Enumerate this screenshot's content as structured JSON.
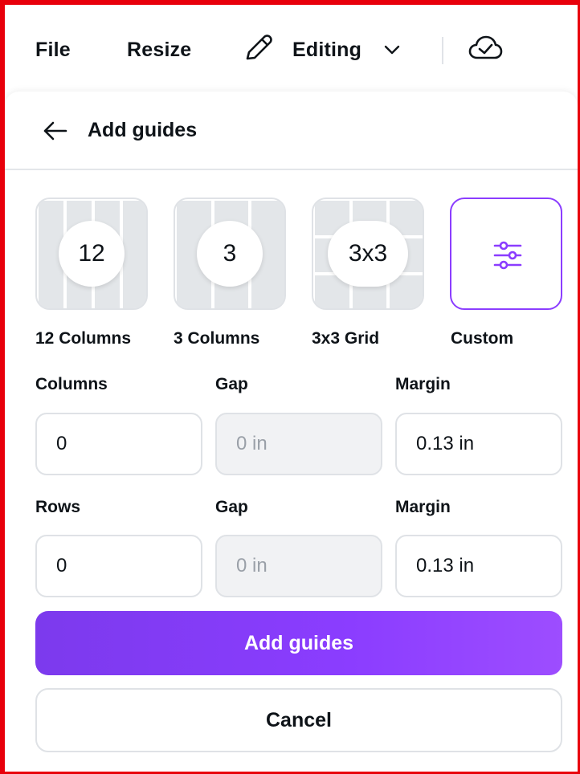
{
  "topbar": {
    "file_label": "File",
    "resize_label": "Resize",
    "mode_label": "Editing"
  },
  "panel": {
    "title": "Add guides"
  },
  "presets": [
    {
      "badge": "12",
      "label": "12 Columns"
    },
    {
      "badge": "3",
      "label": "3 Columns"
    },
    {
      "badge": "3x3",
      "label": "3x3 Grid"
    },
    {
      "badge": "",
      "label": "Custom",
      "selected": true
    }
  ],
  "columns_row": {
    "count_label": "Columns",
    "count_value": "0",
    "gap_label": "Gap",
    "gap_placeholder": "0 in",
    "margin_label": "Margin",
    "margin_value": "0.13 in"
  },
  "rows_row": {
    "count_label": "Rows",
    "count_value": "0",
    "gap_label": "Gap",
    "gap_placeholder": "0 in",
    "margin_label": "Margin",
    "margin_value": "0.13 in"
  },
  "actions": {
    "primary_label": "Add guides",
    "secondary_label": "Cancel"
  },
  "colors": {
    "accent": "#8b3dff",
    "frame": "#e8000b",
    "text": "#0e1318",
    "muted": "#9aa0a8"
  },
  "icons": [
    "pencil-icon",
    "chevron-down-icon",
    "cloud-check-icon",
    "arrow-left-icon",
    "sliders-icon"
  ]
}
